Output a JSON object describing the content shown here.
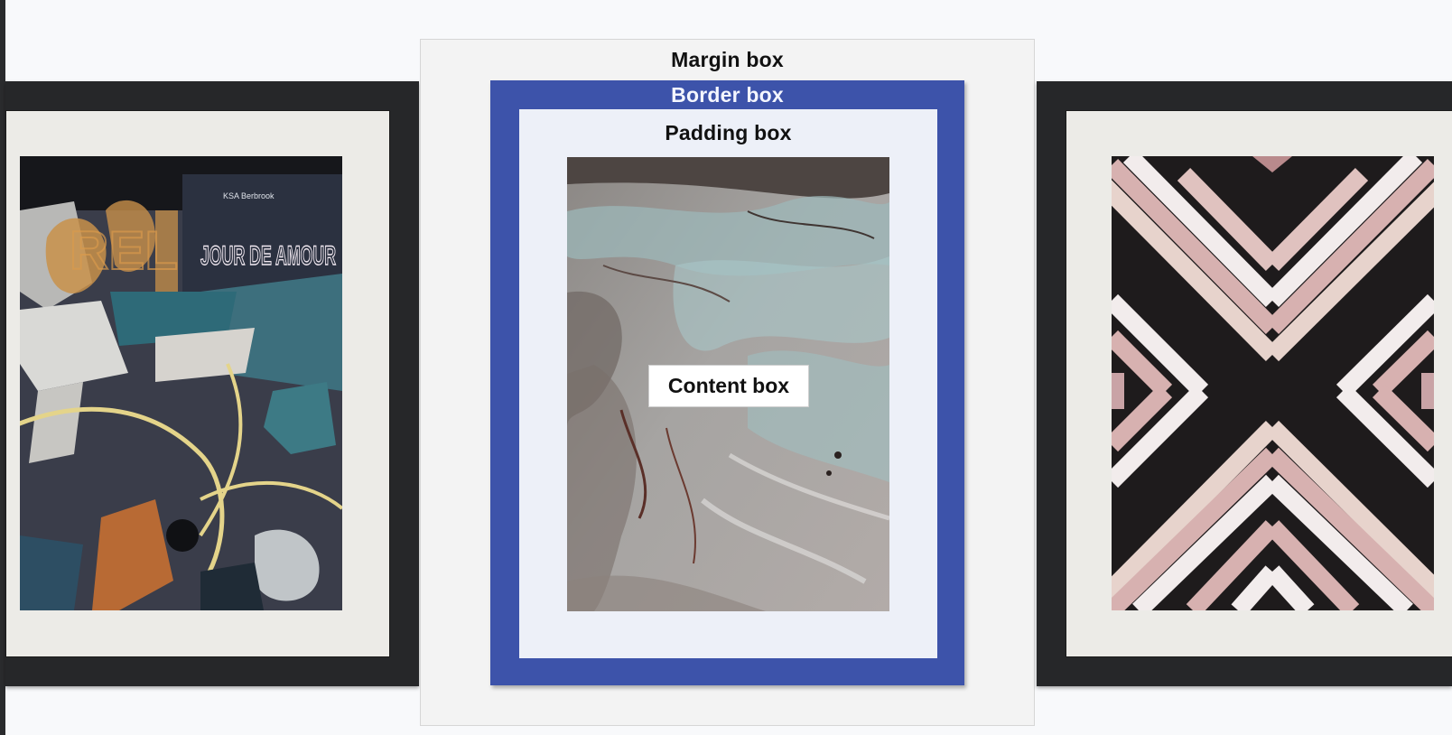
{
  "diagram": {
    "margin_box_label": "Margin box",
    "border_box_label": "Border box",
    "padding_box_label": "Padding box",
    "content_box_label": "Content box"
  },
  "artwork": {
    "left": {
      "poster_brand": "KSA Berbrook",
      "poster_title": "JOUR DE AMOUR",
      "graffiti": "REL"
    }
  },
  "colors": {
    "border_box": "#3d53aa",
    "padding_box": "#edf0f8",
    "margin_box": "#f3f3f3",
    "frame": "#262729",
    "mat": "#ecebe7"
  }
}
